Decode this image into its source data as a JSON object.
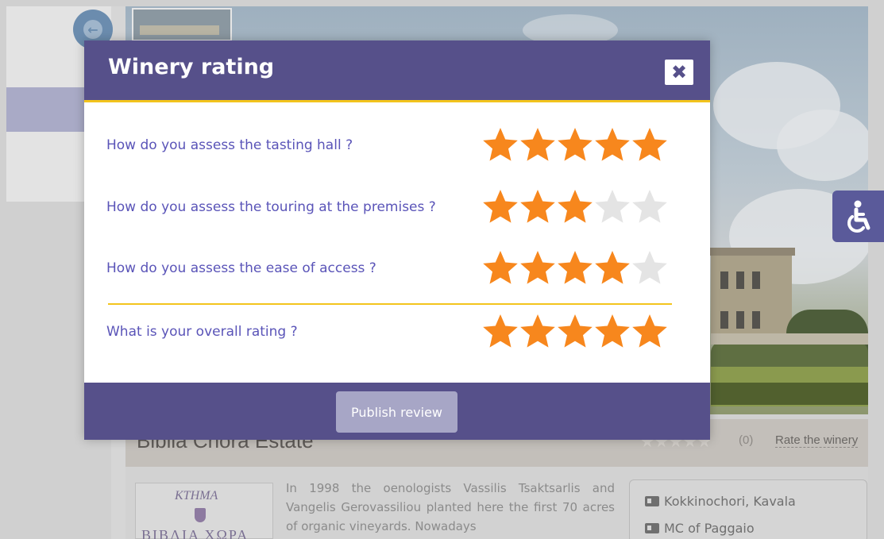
{
  "modal": {
    "title": "Winery rating",
    "close_icon": "close-icon",
    "publish_label": "Publish review"
  },
  "ratings": [
    {
      "question": "How do you assess the tasting hall ?",
      "value": 5,
      "max": 5
    },
    {
      "question": "How do you assess the touring at the premises ?",
      "value": 3,
      "max": 5
    },
    {
      "question": "How do you assess the ease of access ?",
      "value": 4,
      "max": 5
    }
  ],
  "overall": {
    "question": "What is your overall rating ?",
    "value": 5,
    "max": 5
  },
  "background": {
    "estate_name": "Biblia Chora Estate",
    "rating_count": "(0)",
    "rate_link": "Rate the winery",
    "description": "In 1998 the oenologists Vassilis Tsaktsarlis and Vangelis Gerovassiliou planted here the first 70 acres of organic vineyards. Nowadays",
    "logo_top": "KTHMA",
    "logo_bottom": "BIBΛIA XΩPA",
    "address_lines": [
      "Kokkinochori, Kavala",
      "MC of Paggaio"
    ]
  },
  "colors": {
    "header": "#56508a",
    "accent": "#f3c41d",
    "star_filled": "#f7871d",
    "star_empty": "#e4e4e4",
    "question_text": "#5a54b8"
  }
}
